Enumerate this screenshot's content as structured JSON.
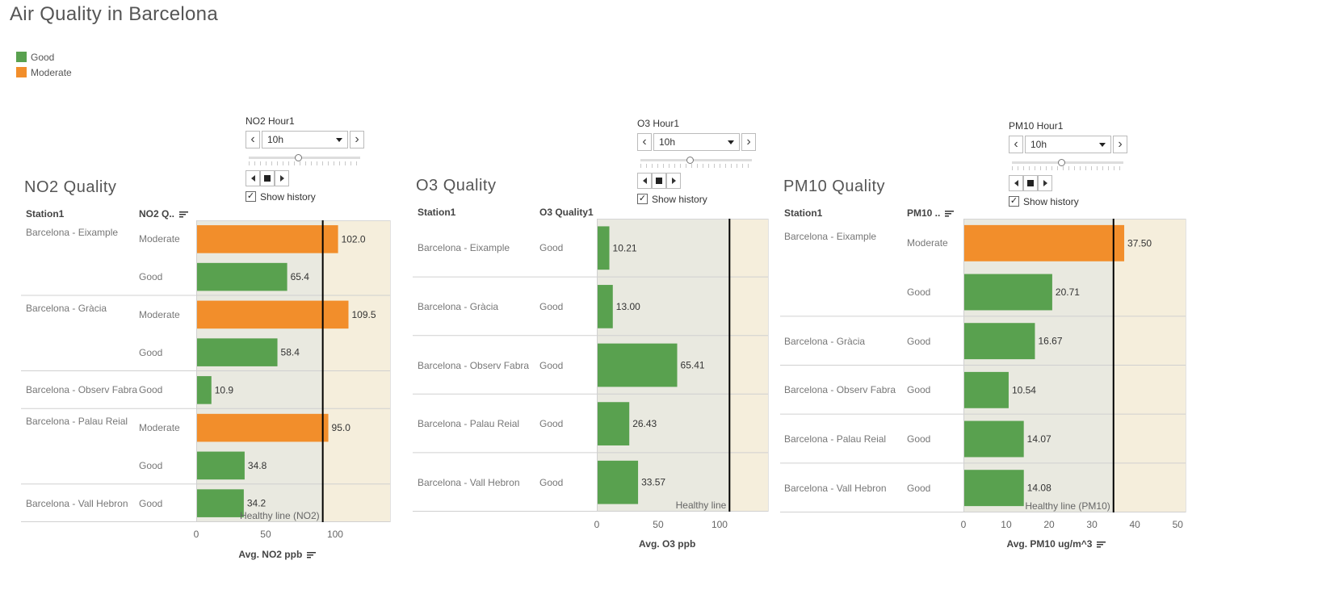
{
  "page": {
    "title": "Air Quality in Barcelona"
  },
  "legend": [
    {
      "label": "Good",
      "color": "#59a14f"
    },
    {
      "label": "Moderate",
      "color": "#f28e2b"
    }
  ],
  "colors": {
    "good": "#59a14f",
    "moderate": "#f28e2b",
    "below_band": "#e9e9e0",
    "above_band": "#f5eedc",
    "healthy_line": "#000000"
  },
  "panels": [
    {
      "id": "no2",
      "title": "NO2 Quality",
      "col_station": "Station1",
      "col_quality": "NO2 Q..",
      "axis_title": "Avg. NO2 ppb",
      "control": {
        "title": "NO2 Hour1",
        "selected": "10h",
        "show_history_label": "Show history",
        "show_history_checked": true,
        "position": 0.45
      },
      "ref_line_label": "Healthy line (NO2)",
      "chart_data": {
        "type": "bar",
        "orientation": "horizontal",
        "xlabel": "Avg. NO2 ppb",
        "xlim": [
          0,
          140
        ],
        "xticks": [
          0,
          50,
          100
        ],
        "reference_line": {
          "value": 91,
          "label": "Healthy line (NO2)"
        },
        "decimals": 1,
        "groups": [
          {
            "station": "Barcelona - Eixample",
            "rows": [
              {
                "quality": "Moderate",
                "value": 102.0,
                "label": "102.0"
              },
              {
                "quality": "Good",
                "value": 65.4,
                "label": "65.4"
              }
            ]
          },
          {
            "station": "Barcelona - Gràcia",
            "rows": [
              {
                "quality": "Moderate",
                "value": 109.5,
                "label": "109.5"
              },
              {
                "quality": "Good",
                "value": 58.4,
                "label": "58.4"
              }
            ]
          },
          {
            "station": "Barcelona - Observ Fabra",
            "rows": [
              {
                "quality": "Good",
                "value": 10.9,
                "label": "10.9"
              }
            ]
          },
          {
            "station": "Barcelona - Palau Reial",
            "rows": [
              {
                "quality": "Moderate",
                "value": 95.0,
                "label": "95.0"
              },
              {
                "quality": "Good",
                "value": 34.8,
                "label": "34.8"
              }
            ]
          },
          {
            "station": "Barcelona - Vall Hebron",
            "rows": [
              {
                "quality": "Good",
                "value": 34.2,
                "label": "34.2"
              }
            ]
          }
        ]
      }
    },
    {
      "id": "o3",
      "title": "O3 Quality",
      "col_station": "Station1",
      "col_quality": "O3 Quality1",
      "axis_title": "Avg. O3 ppb",
      "control": {
        "title": "O3 Hour1",
        "selected": "10h",
        "show_history_label": "Show history",
        "show_history_checked": true,
        "position": 0.45
      },
      "ref_line_label": "Healthy line",
      "chart_data": {
        "type": "bar",
        "orientation": "horizontal",
        "xlabel": "Avg. O3 ppb",
        "xlim": [
          0,
          140
        ],
        "xticks": [
          0,
          50,
          100
        ],
        "reference_line": {
          "value": 108,
          "label": "Healthy line"
        },
        "decimals": 2,
        "groups": [
          {
            "station": "Barcelona - Eixample",
            "rows": [
              {
                "quality": "Good",
                "value": 10.21,
                "label": "10.21"
              }
            ]
          },
          {
            "station": "Barcelona - Gràcia",
            "rows": [
              {
                "quality": "Good",
                "value": 13.0,
                "label": "13.00"
              }
            ]
          },
          {
            "station": "Barcelona - Observ Fabra",
            "rows": [
              {
                "quality": "Good",
                "value": 65.41,
                "label": "65.41"
              }
            ]
          },
          {
            "station": "Barcelona - Palau Reial",
            "rows": [
              {
                "quality": "Good",
                "value": 26.43,
                "label": "26.43"
              }
            ]
          },
          {
            "station": "Barcelona - Vall Hebron",
            "rows": [
              {
                "quality": "Good",
                "value": 33.57,
                "label": "33.57"
              }
            ]
          }
        ]
      }
    },
    {
      "id": "pm10",
      "title": "PM10 Quality",
      "col_station": "Station1",
      "col_quality": "PM10 ..",
      "axis_title": "Avg. PM10 ug/m^3",
      "control": {
        "title": "PM10 Hour1",
        "selected": "10h",
        "show_history_label": "Show history",
        "show_history_checked": true,
        "position": 0.45
      },
      "ref_line_label": "Healthy line (PM10)",
      "chart_data": {
        "type": "bar",
        "orientation": "horizontal",
        "xlabel": "Avg. PM10 ug/m^3",
        "xlim": [
          0,
          52
        ],
        "xticks": [
          0,
          10,
          20,
          30,
          40,
          50
        ],
        "reference_line": {
          "value": 35,
          "label": "Healthy line (PM10)"
        },
        "decimals": 2,
        "groups": [
          {
            "station": "Barcelona - Eixample",
            "rows": [
              {
                "quality": "Moderate",
                "value": 37.5,
                "label": "37.50"
              },
              {
                "quality": "Good",
                "value": 20.71,
                "label": "20.71"
              }
            ]
          },
          {
            "station": "Barcelona - Gràcia",
            "rows": [
              {
                "quality": "Good",
                "value": 16.67,
                "label": "16.67"
              }
            ]
          },
          {
            "station": "Barcelona - Observ Fabra",
            "rows": [
              {
                "quality": "Good",
                "value": 10.54,
                "label": "10.54"
              }
            ]
          },
          {
            "station": "Barcelona - Palau Reial",
            "rows": [
              {
                "quality": "Good",
                "value": 14.07,
                "label": "14.07"
              }
            ]
          },
          {
            "station": "Barcelona - Vall Hebron",
            "rows": [
              {
                "quality": "Good",
                "value": 14.08,
                "label": "14.08"
              }
            ]
          }
        ]
      }
    }
  ]
}
